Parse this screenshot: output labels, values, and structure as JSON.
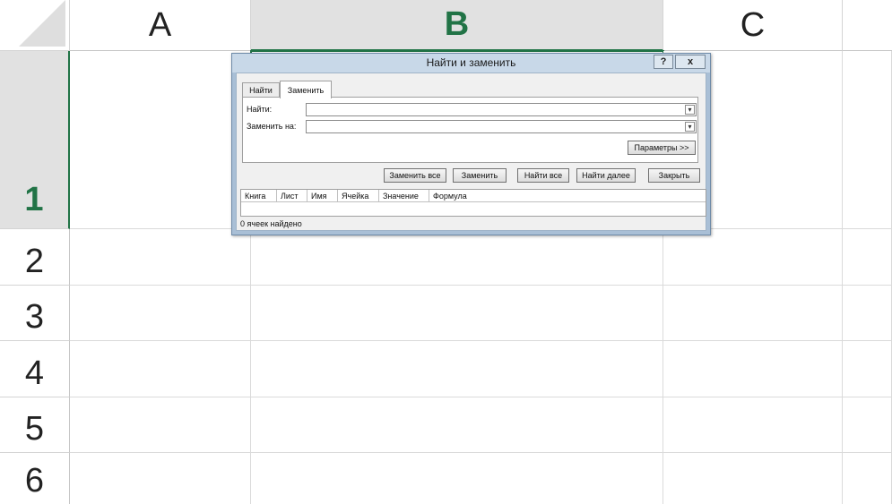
{
  "columns": [
    "A",
    "B",
    "C"
  ],
  "rows": [
    "1",
    "2",
    "3",
    "4",
    "5",
    "6"
  ],
  "selected_column": "B",
  "selected_row": "1",
  "accent_color": "#217346",
  "dialog": {
    "title": "Найти и заменить",
    "help_label": "?",
    "close_label": "x",
    "tabs": [
      "Найти",
      "Заменить"
    ],
    "active_tab": "Заменить",
    "find_label": "Найти:",
    "find_value": "",
    "replace_label": "Заменить на:",
    "replace_value": "",
    "options_button": "Параметры >>",
    "buttons": {
      "replace_all": "Заменить все",
      "replace": "Заменить",
      "find_all": "Найти все",
      "find_next": "Найти далее",
      "close": "Закрыть"
    },
    "result_columns": [
      "Книга",
      "Лист",
      "Имя",
      "Ячейка",
      "Значение",
      "Формула"
    ],
    "status": "0 ячеек найдено"
  }
}
